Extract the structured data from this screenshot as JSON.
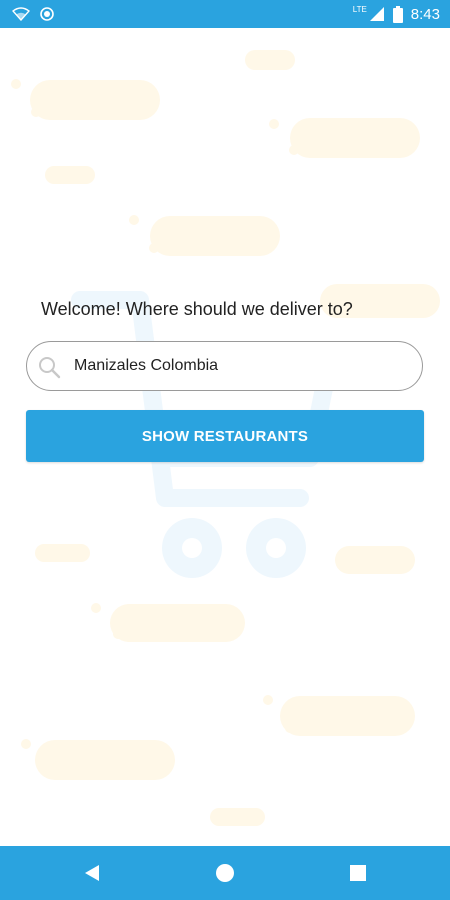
{
  "status_bar": {
    "time": "8:43",
    "network_label": "LTE",
    "icons": [
      "wifi-icon",
      "sync-icon",
      "signal-icon",
      "battery-icon"
    ]
  },
  "main": {
    "welcome_text": "Welcome! Where should we deliver to?",
    "search": {
      "value": "Manizales Colombia",
      "icon": "search-icon"
    },
    "show_button_label": "SHOW RESTAURANTS"
  },
  "nav_bar": {
    "icons": [
      "back-icon",
      "home-icon",
      "recents-icon"
    ]
  },
  "colors": {
    "accent": "#2aa3df",
    "background_decoration": "#fff8e8",
    "background_cart": "#eef7fd"
  }
}
